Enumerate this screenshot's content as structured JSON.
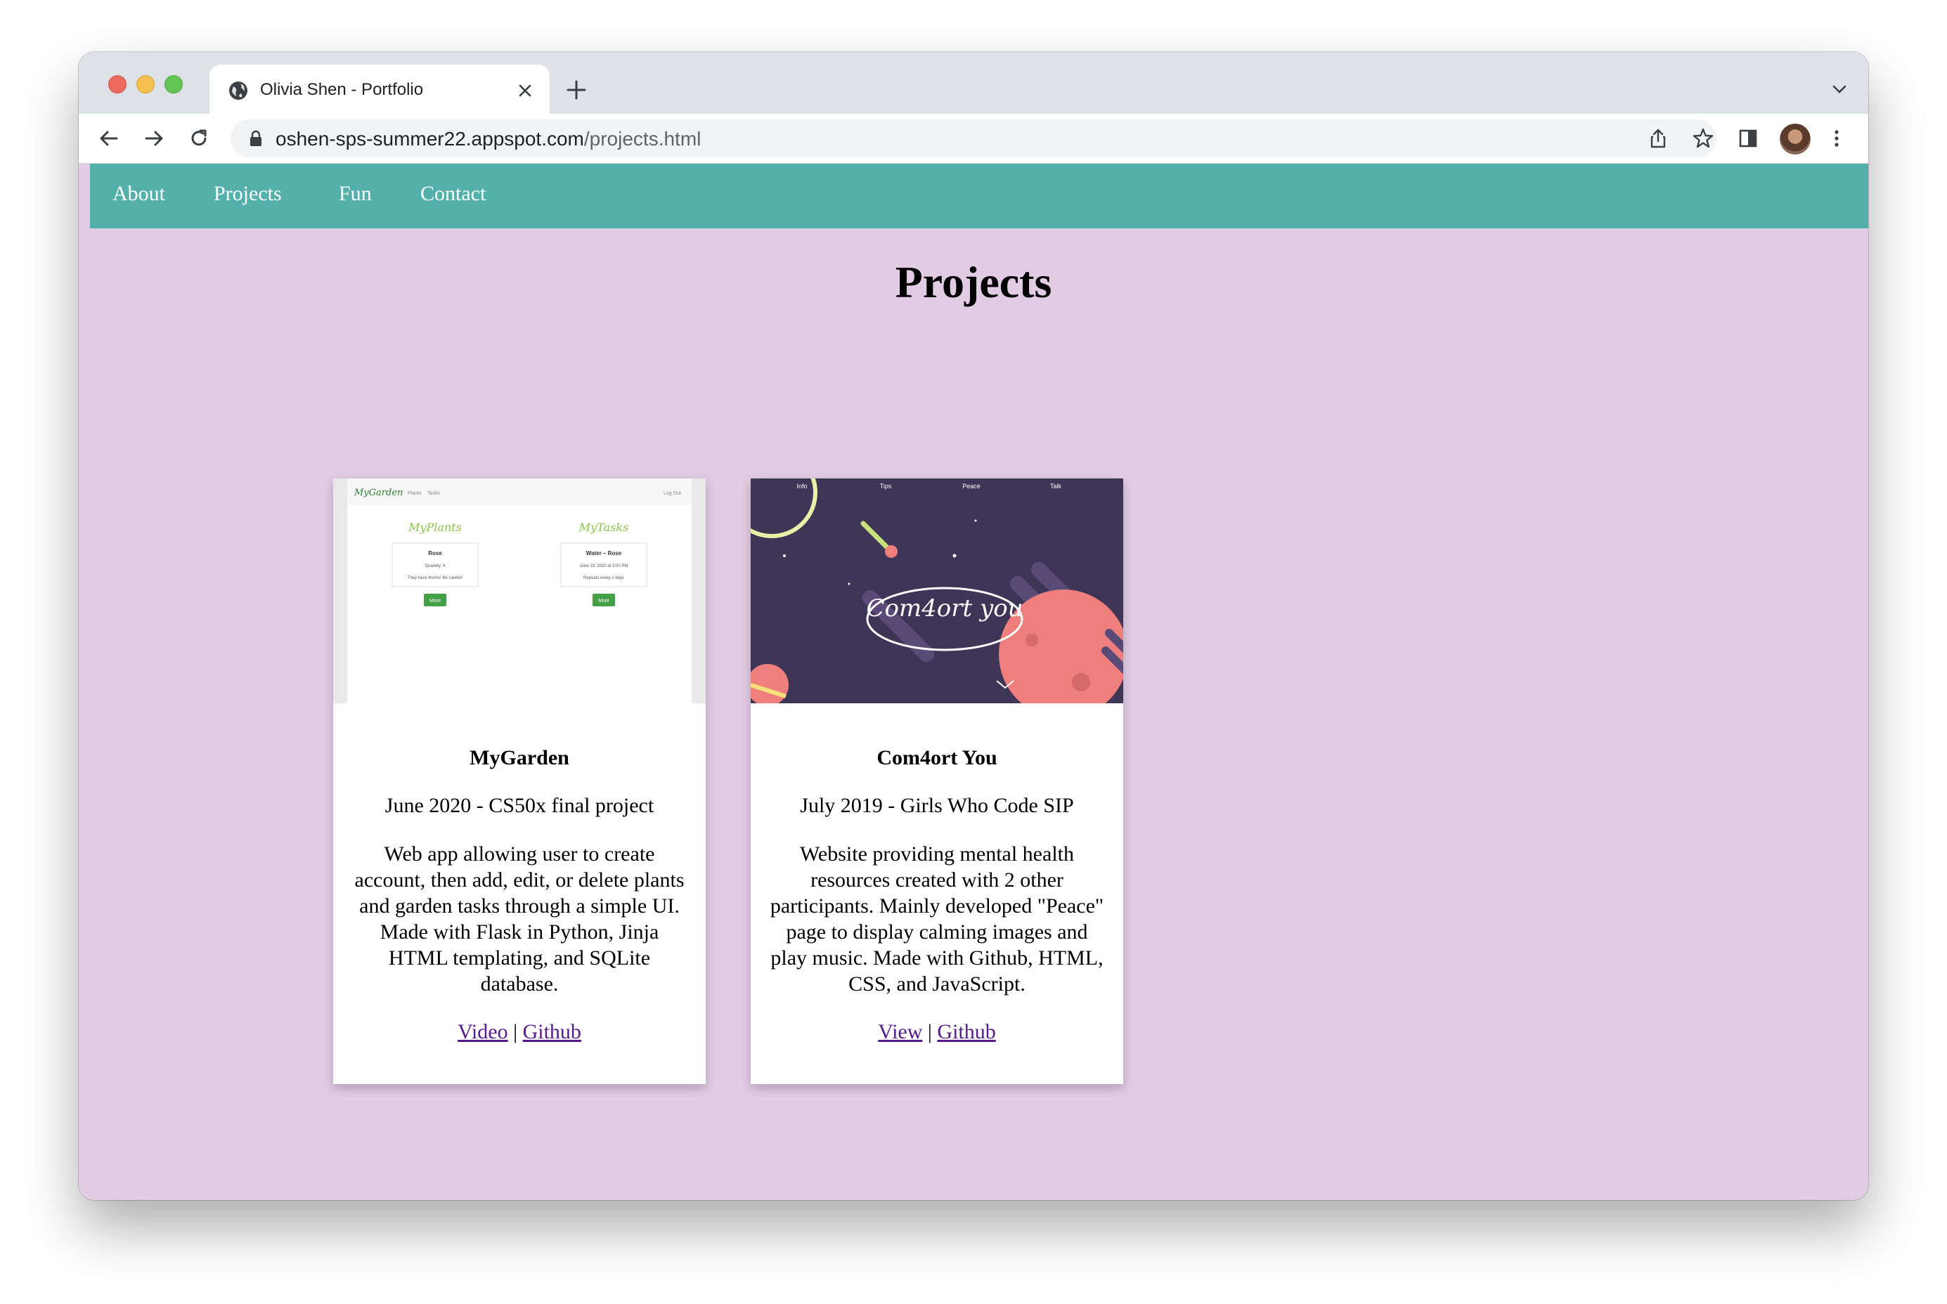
{
  "browser": {
    "tab_title": "Olivia Shen - Portfolio",
    "url_host": "oshen-sps-summer22.appspot.com",
    "url_path": "/projects.html"
  },
  "nav": {
    "items": [
      {
        "label": "About"
      },
      {
        "label": "Projects"
      },
      {
        "label": "Fun"
      },
      {
        "label": "Contact"
      }
    ]
  },
  "page": {
    "title": "Projects"
  },
  "projects": [
    {
      "title": "MyGarden",
      "date": "June 2020 - CS50x final project",
      "description": "Web app allowing user to create account, then add, edit, or delete plants and garden tasks through a simple UI. Made with Flask in Python, Jinja HTML templating, and SQLite database.",
      "link1": "Video",
      "separator": "|",
      "link2": "Github",
      "thumb": {
        "brand": "MyGarden",
        "nav_plants": "Plants",
        "nav_tasks": "Tasks",
        "logout": "Log Out",
        "col1_title": "MyPlants",
        "col2_title": "MyTasks",
        "plant_name": "Rose",
        "plant_qty": "Quantity: 4",
        "plant_note": "They have thorns! Be careful!",
        "task_name": "Water – Rose",
        "task_date": "June 19, 2020 at 3:00 PM",
        "task_repeat": "Repeats every 2 days",
        "more": "More"
      }
    },
    {
      "title": "Com4ort You",
      "date": "July 2019 - Girls Who Code SIP",
      "description": "Website providing mental health resources created with 2 other participants. Mainly developed \"Peace\" page to display calming images and play music. Made with Github, HTML, CSS, and JavaScript.",
      "link1": "View",
      "separator": "|",
      "link2": "Github",
      "thumb": {
        "nav": [
          "Info",
          "Tips",
          "Peace",
          "Talk"
        ],
        "logo_text": "Com4ort you"
      }
    }
  ],
  "colors": {
    "navbar": "#53b0aa",
    "page_bg": "#e2cce4",
    "link": "#551a8b"
  }
}
